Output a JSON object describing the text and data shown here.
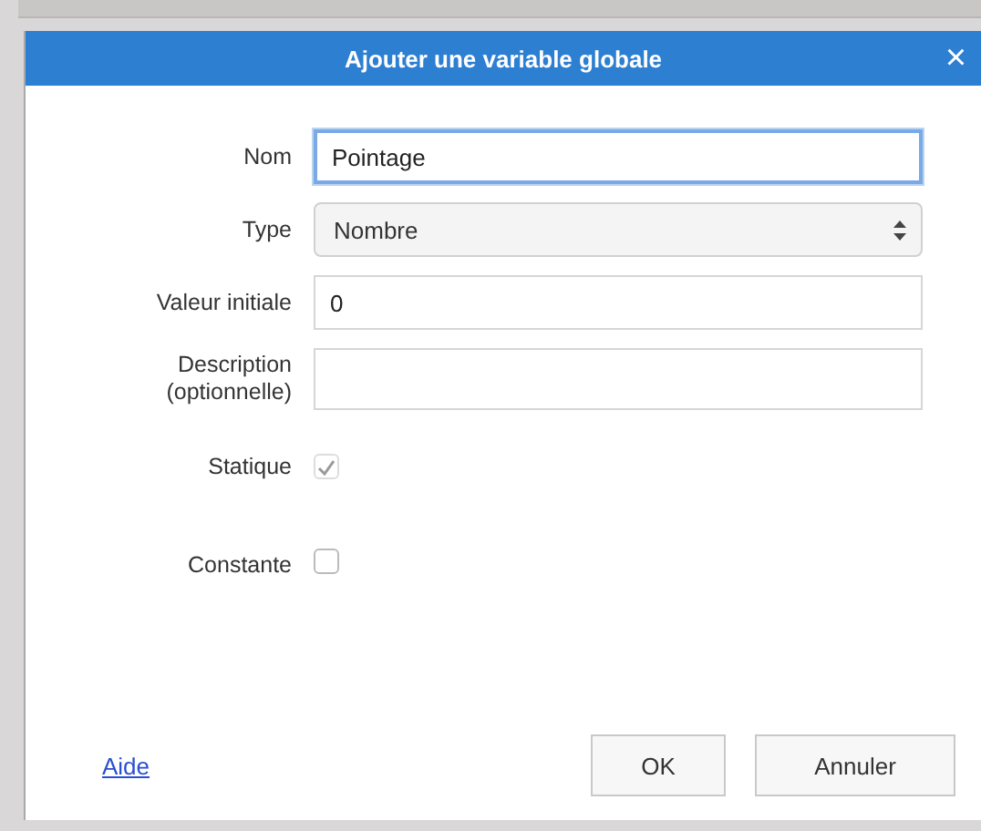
{
  "dialog": {
    "title": "Ajouter une variable globale",
    "close": "×"
  },
  "fields": [
    {
      "kind": "text",
      "label": "Nom",
      "value": "Pointage",
      "focused": true
    },
    {
      "kind": "select",
      "label": "Type",
      "value": "Nombre"
    },
    {
      "kind": "text",
      "label": "Valeur initiale",
      "value": "0",
      "focused": false
    },
    {
      "kind": "textarea",
      "label": "Description (optionnelle)"
    },
    {
      "kind": "checkbox",
      "label": "Statique",
      "checked": true,
      "disabled": true
    },
    {
      "kind": "checkbox",
      "label": "Constante",
      "checked": false,
      "disabled": false
    }
  ],
  "help_link": "Aide",
  "buttons": [
    "OK",
    "Annuler"
  ]
}
